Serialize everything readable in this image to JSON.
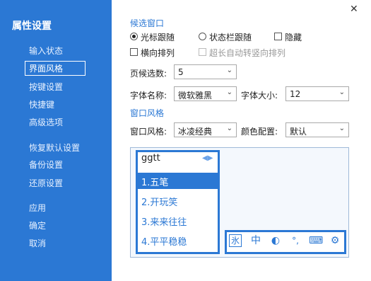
{
  "sidebar": {
    "title": "属性设置",
    "items": [
      {
        "label": "输入状态"
      },
      {
        "label": "界面风格"
      },
      {
        "label": "按键设置"
      },
      {
        "label": "快捷键"
      },
      {
        "label": "高级选项"
      },
      {
        "label": "恢复默认设置"
      },
      {
        "label": "备份设置"
      },
      {
        "label": "还原设置"
      },
      {
        "label": "应用"
      },
      {
        "label": "确定"
      },
      {
        "label": "取消"
      }
    ],
    "active": "界面风格"
  },
  "candidate_window": {
    "section_title": "候选窗口",
    "follow_cursor": "光标跟随",
    "follow_statusbar": "状态栏跟随",
    "hide": "隐藏",
    "horizontal": "横向排列",
    "auto_vertical": "超长自动转竖向排列",
    "per_page_label": "页候选数:",
    "per_page_value": "5",
    "font_name_label": "字体名称:",
    "font_name_value": "微软雅黑",
    "font_size_label": "字体大小:",
    "font_size_value": "12"
  },
  "window_style": {
    "section_title": "窗口风格",
    "style_label": "窗口风格:",
    "style_value": "冰凌经典",
    "color_label": "颜色配置:",
    "color_value": "默认"
  },
  "preview": {
    "code": "ggtt",
    "candidates": [
      "1.五笔",
      "2.开玩笑",
      "3.来来往往",
      "4.平平稳稳"
    ],
    "toolbar": [
      {
        "icon": "ice-icon",
        "glyph": "氷"
      },
      {
        "icon": "chinese-mode-icon",
        "glyph": "中"
      },
      {
        "icon": "half-moon-icon",
        "glyph": "◐"
      },
      {
        "icon": "punctuation-icon",
        "glyph": "°,"
      },
      {
        "icon": "keyboard-icon",
        "glyph": "⌨"
      },
      {
        "icon": "gear-icon",
        "glyph": "⚙"
      }
    ]
  },
  "colors": {
    "accent": "#2b78d4",
    "sidebar_bg": "#2b78d4"
  }
}
